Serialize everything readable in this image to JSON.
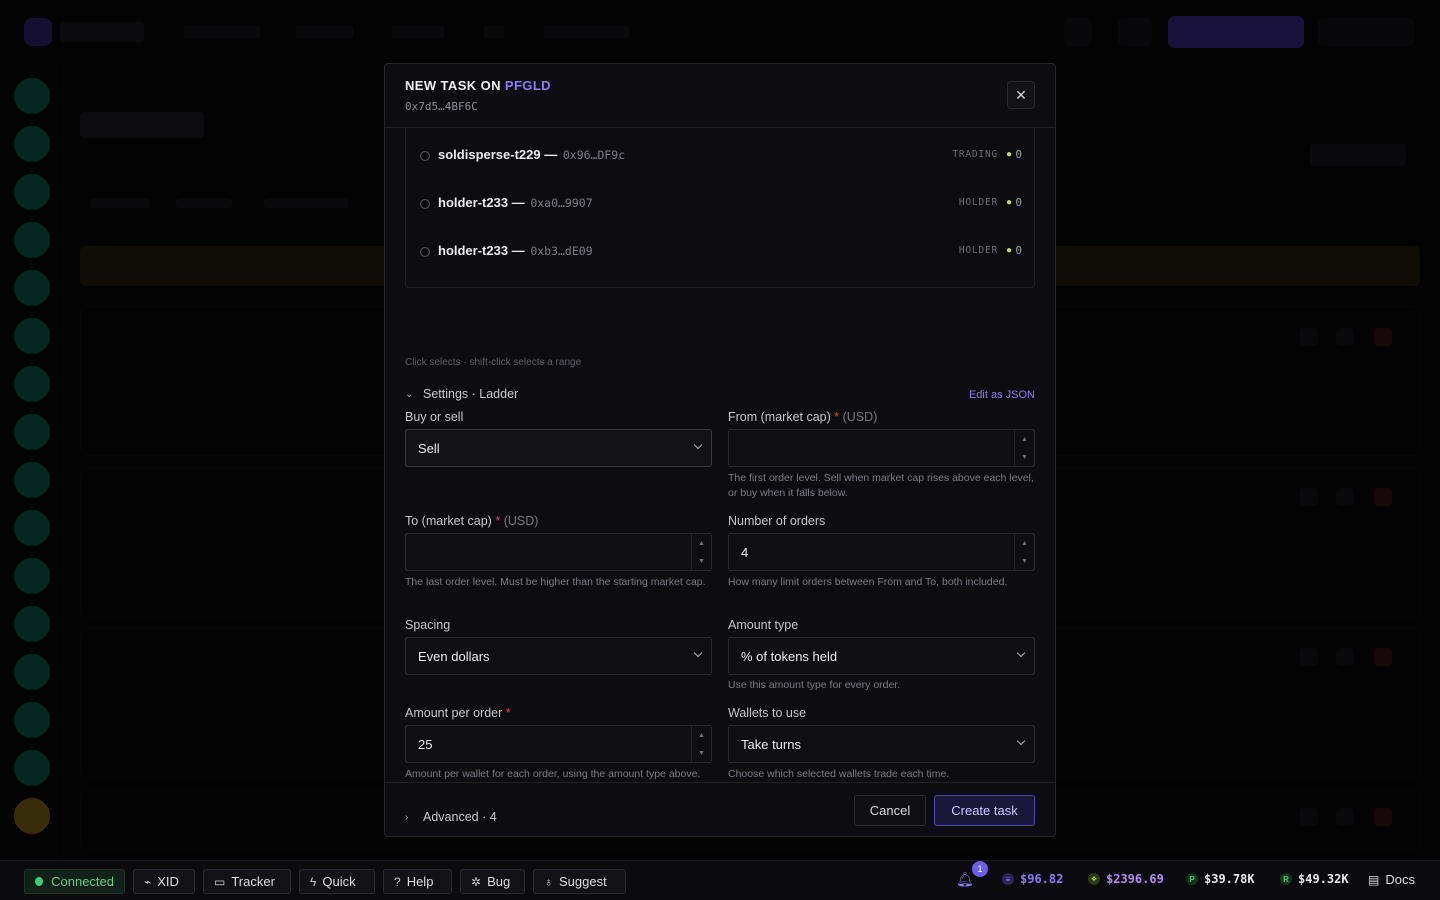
{
  "modal": {
    "title_prefix": "NEW TASK ON",
    "title_symbol": "PFGLD",
    "contract": "0x7d5…4BF6C",
    "close_icon": "close-icon"
  },
  "wallets": [
    {
      "name": "soldisperse-t229 —",
      "address": "0x96…DF9c",
      "tag": "TRADING",
      "count": "0"
    },
    {
      "name": "holder-t233 —",
      "address": "0xa0…9907",
      "tag": "HOLDER",
      "count": "0"
    },
    {
      "name": "holder-t233 —",
      "address": "0xb3…dE09",
      "tag": "HOLDER",
      "count": "0"
    }
  ],
  "wallet_hint": "Click selects · shift-click selects a range",
  "settings": {
    "toggle_label": "Settings · Ladder",
    "edit_json": "Edit as JSON",
    "buy_or_sell": {
      "label": "Buy or sell",
      "value": "Sell"
    },
    "from": {
      "label": "From (market cap)",
      "required": "*",
      "unit": "(USD)",
      "value": "",
      "help": "The first order level. Sell when market cap rises above each level, or buy when it falls below."
    },
    "to": {
      "label": "To (market cap)",
      "required": "*",
      "unit": "(USD)",
      "value": "",
      "help": "The last order level. Must be higher than the starting market cap."
    },
    "orders": {
      "label": "Number of orders",
      "value": "4",
      "help": "How many limit orders between From and To, both included."
    },
    "spacing": {
      "label": "Spacing",
      "value": "Even dollars"
    },
    "amount_type": {
      "label": "Amount type",
      "value": "% of tokens held",
      "help": "Use this amount type for every order."
    },
    "amount_per_order": {
      "label": "Amount per order",
      "required": "*",
      "value": "25",
      "help": "Amount per wallet for each order, using the amount type above."
    },
    "wallets_to_use": {
      "label": "Wallets to use",
      "value": "Take turns",
      "help": "Choose which selected wallets trade each time."
    }
  },
  "advanced_label": "Advanced · 4",
  "footer": {
    "cancel": "Cancel",
    "create": "Create task"
  },
  "statusbar": {
    "connected": "Connected",
    "buttons": [
      "XID",
      "Tracker",
      "Quick",
      "Help",
      "Bug",
      "Suggest"
    ],
    "notifications": "1",
    "prices": [
      {
        "icon": "solana-icon",
        "value": "$96.82",
        "color": "#8b7cf6"
      },
      {
        "icon": "eth-icon",
        "value": "$2396.69",
        "color": "#b28cf6"
      },
      {
        "icon": "p-token-icon",
        "value": "$39.78K",
        "color": "#e7e7ec"
      },
      {
        "icon": "r-token-icon",
        "value": "$49.32K",
        "color": "#e7e7ec"
      }
    ],
    "docs": "Docs"
  }
}
